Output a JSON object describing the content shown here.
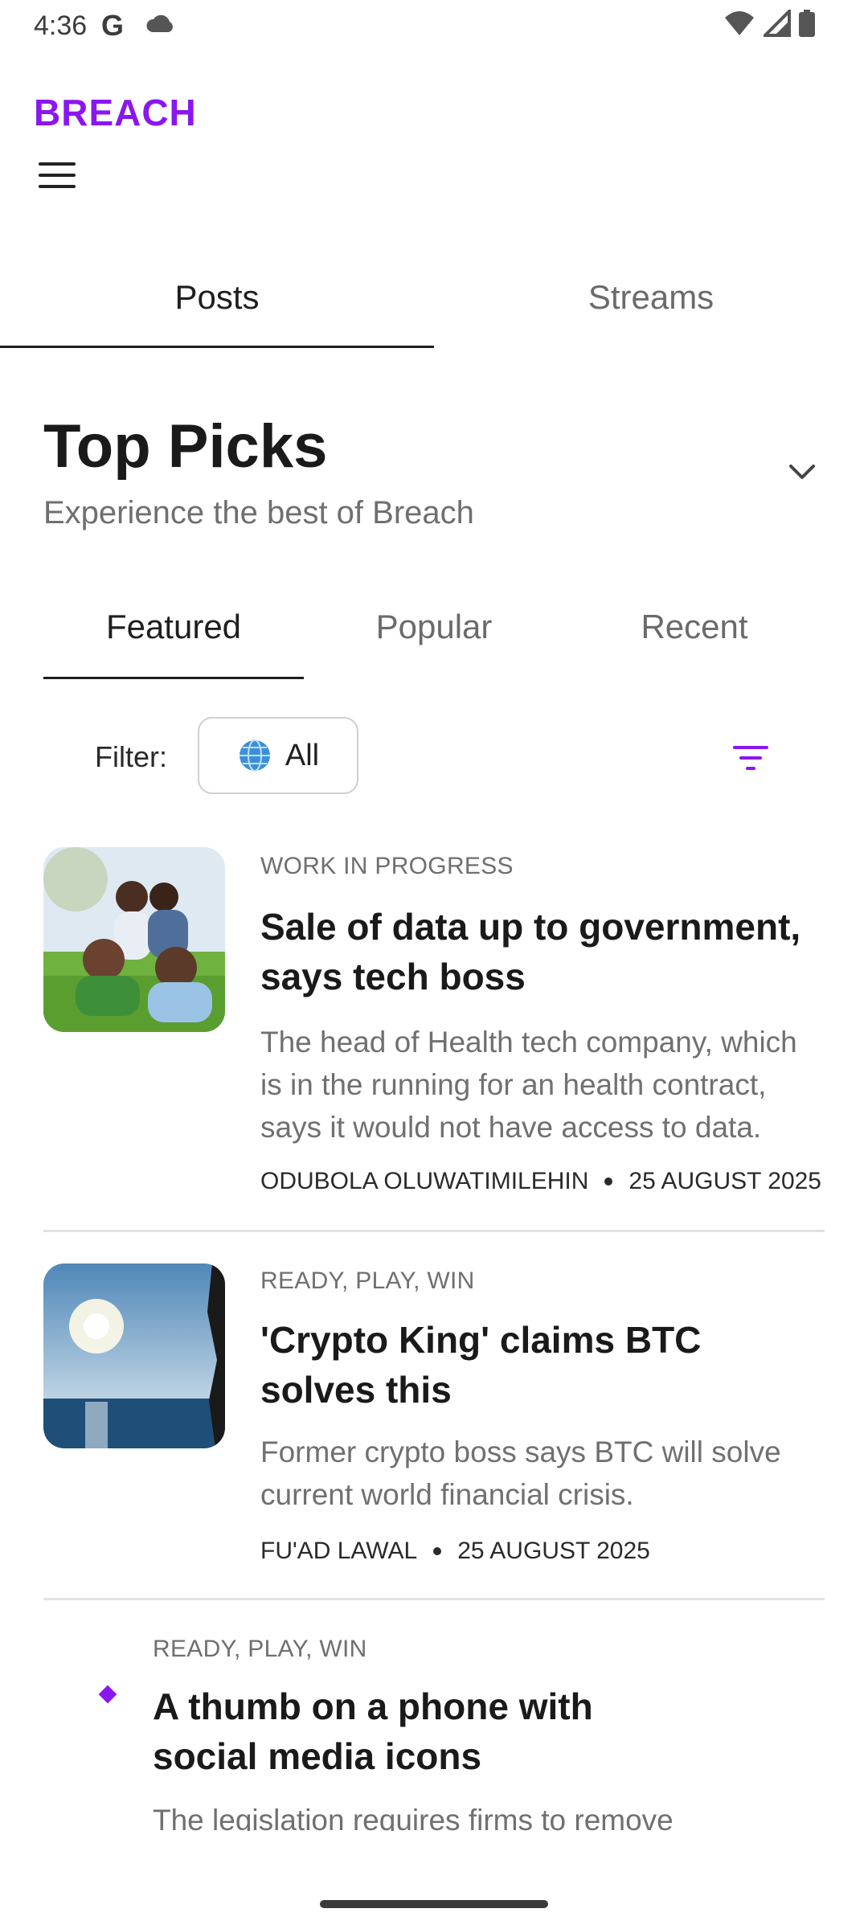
{
  "status_bar": {
    "time": "4:36",
    "google_letter": "G",
    "icons": [
      "cloud-icon",
      "wifi-icon",
      "signal-icon",
      "battery-icon"
    ]
  },
  "header": {
    "logo": "BREACH",
    "menu_icon": "hamburger-menu-icon",
    "brand_color": "#8a16f0"
  },
  "main_tabs": [
    {
      "label": "Posts",
      "active": true
    },
    {
      "label": "Streams",
      "active": false
    }
  ],
  "section": {
    "title": "Top Picks",
    "subtitle": "Experience the best of Breach",
    "expand_icon": "chevron-down-icon"
  },
  "sub_tabs": [
    {
      "label": "Featured",
      "active": true
    },
    {
      "label": "Popular",
      "active": false
    },
    {
      "label": "Recent",
      "active": false
    }
  ],
  "filter": {
    "label": "Filter:",
    "chip_icon": "globe-icon",
    "chip_value": "All",
    "sort_icon": "filter-sort-icon"
  },
  "articles": [
    {
      "kicker": "WORK IN PROGRESS",
      "headline_line1": "Sale of data up to government,",
      "headline_line2": "says tech boss",
      "excerpt_line1": "The head of Health tech company, which",
      "excerpt_line2": "is in the running for an health contract,",
      "excerpt_line3": "says it would not have access to data.",
      "author": "ODUBOLA OLUWATIMILEHIN",
      "date": "25 AUGUST 2025",
      "image": "family-photo"
    },
    {
      "kicker": "READY, PLAY, WIN",
      "headline_line1": "'Crypto King' claims BTC",
      "headline_line2": "solves this",
      "excerpt_line1": "Former crypto boss says BTC will solve",
      "excerpt_line2": "current world financial crisis.",
      "author": "FU'AD LAWAL",
      "date": "25 AUGUST 2025",
      "image": "sea-sunset-photo"
    },
    {
      "kicker": "READY, PLAY, WIN",
      "headline_line1": "A thumb on a phone with",
      "headline_line2": "social media icons",
      "excerpt_line1": "The legislation requires firms to remove",
      "image": "broken-image"
    }
  ]
}
